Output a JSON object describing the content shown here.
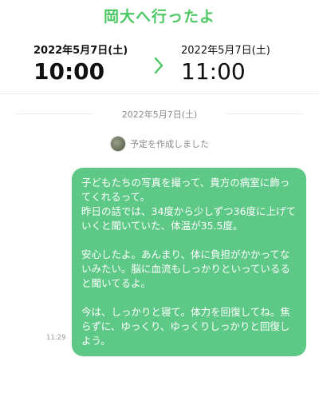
{
  "event": {
    "title": "岡大へ行ったよ",
    "start_date": "2022年5月7日(土)",
    "start_time": "10:00",
    "end_date": "2022年5月7日(土)",
    "end_time": "11:00"
  },
  "chat": {
    "date_separator": "2022年5月7日(土)",
    "system_message": "予定を作成しました",
    "message": {
      "text": "子どもたちの写真を撮って、貴方の病室に飾ってくれるって。\n昨日の話では、34度から少しずつ36度に上げていくと聞いていた、体温が35.5度。\n\n安心したよ。あんまり、体に負担がかかってないみたい。脳に血流もしっかりといっているると聞いてるよ。\n\n今は、しっかりと寝て。体力を回復してね。焦らずに、ゆっくり、ゆっくりしっかりと回復しよう。",
      "time": "11:29"
    }
  },
  "colors": {
    "accent": "#4cc764",
    "bubble": "#5ec886"
  },
  "icons": {
    "arrow": "chevron-right-icon",
    "avatar": "avatar"
  }
}
